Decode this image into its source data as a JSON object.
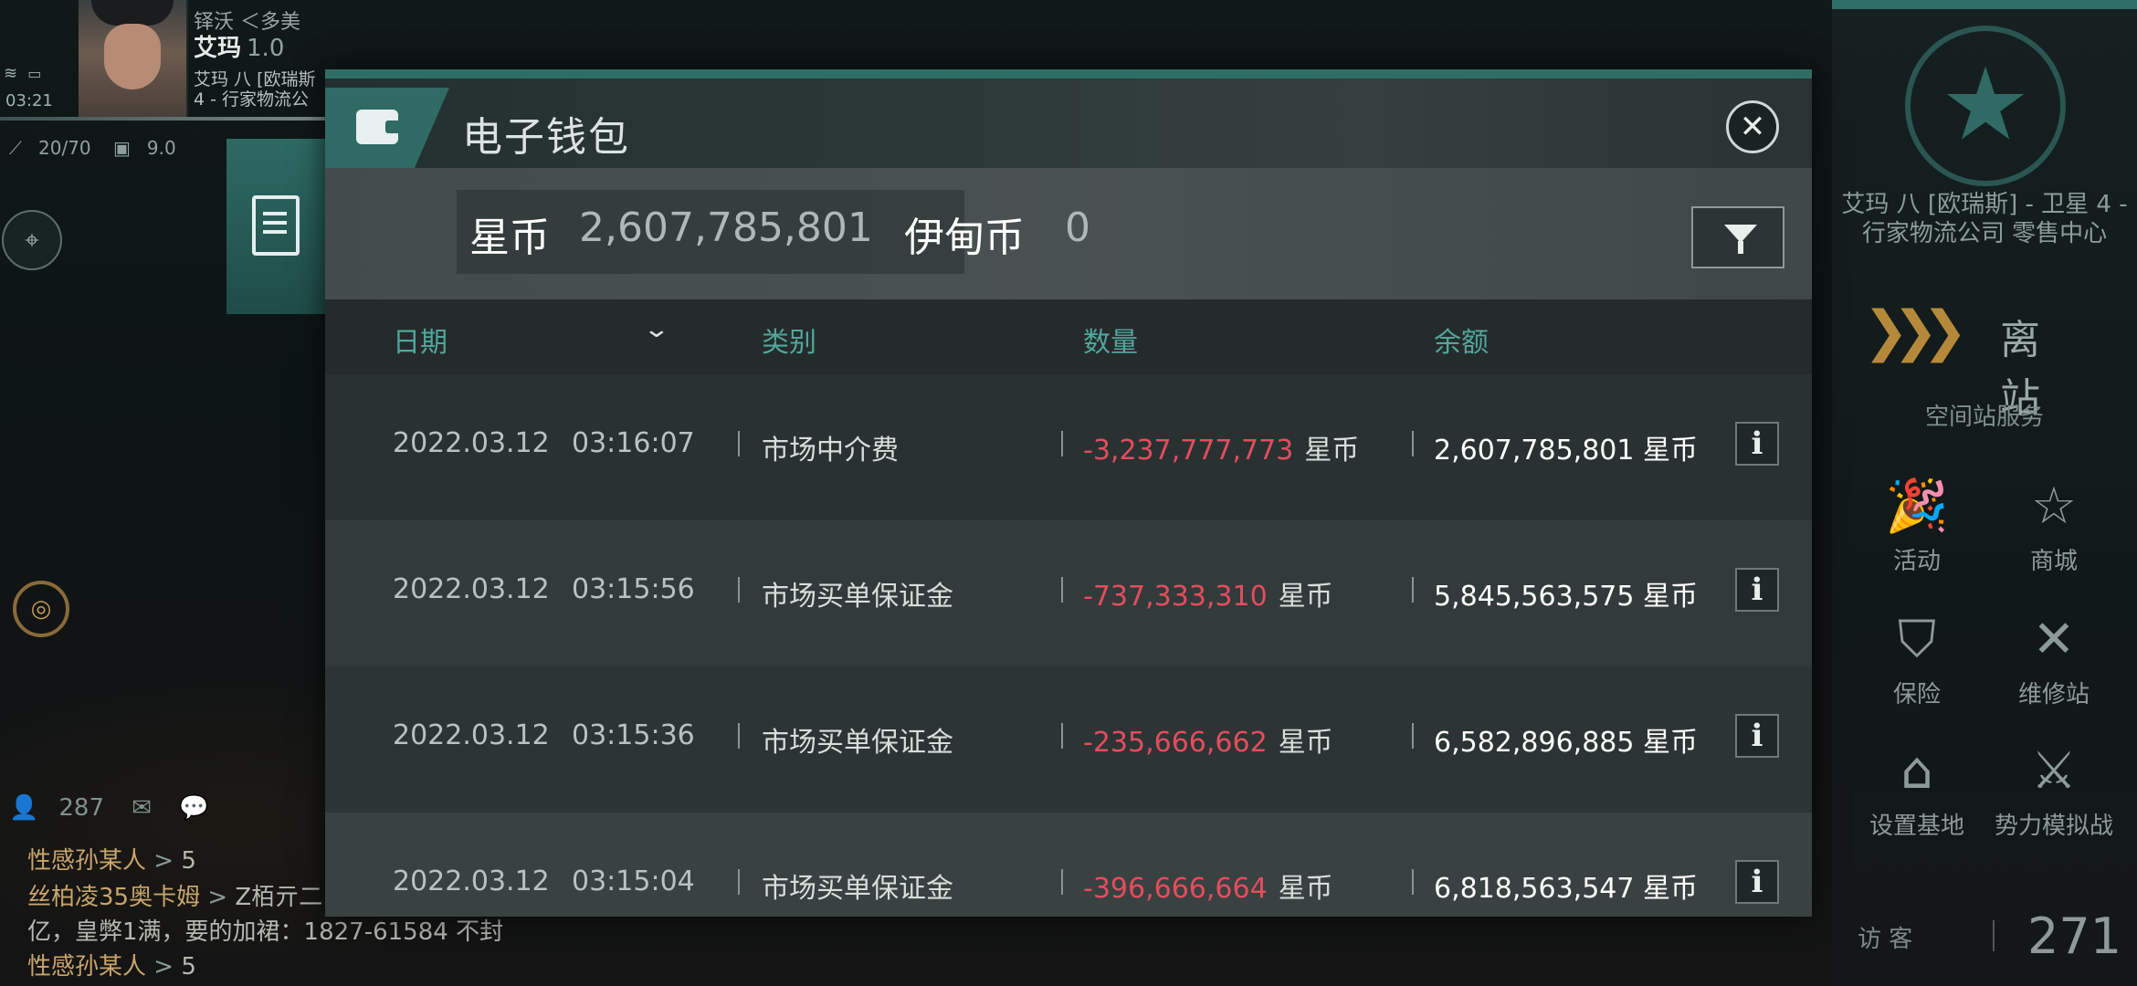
{
  "hud": {
    "time": "03:21",
    "corp": "铎沃 ＜多美",
    "pilot_name": "艾玛",
    "security": "1.0",
    "location_line1": "艾玛 八 [欧瑞斯",
    "location_line2": "4 - 行家物流公",
    "cargo": "20/70",
    "volume": "9.0",
    "contacts": "287"
  },
  "chat": [
    {
      "sender": "性感孙某人",
      "arrow": ">",
      "text": "5"
    },
    {
      "sender": "丝柏凌35奥卡姆",
      "arrow": ">",
      "text": "Z栢亓二"
    },
    {
      "sender": "",
      "arrow": "",
      "text": "亿，皇弊1满，要的加裙：1827-61584 不封"
    },
    {
      "sender": "性感孙某人",
      "arrow": ">",
      "text": "5"
    }
  ],
  "wallet": {
    "title": "电子钱包",
    "isk_label": "星币",
    "isk_value": "2,607,785,801",
    "plex_label": "伊甸币",
    "plex_value": "0",
    "columns": {
      "date": "日期",
      "category": "类别",
      "amount": "数量",
      "balance": "余额"
    },
    "info_label": "i",
    "rows": [
      {
        "date": "2022.03.12",
        "time": "03:16:07",
        "category": "市场中介费",
        "amount": "-3,237,777,773",
        "unit": "星币",
        "balance": "2,607,785,801 星币"
      },
      {
        "date": "2022.03.12",
        "time": "03:15:56",
        "category": "市场买单保证金",
        "amount": "-737,333,310",
        "unit": "星币",
        "balance": "5,845,563,575 星币"
      },
      {
        "date": "2022.03.12",
        "time": "03:15:36",
        "category": "市场买单保证金",
        "amount": "-235,666,662",
        "unit": "星币",
        "balance": "6,582,896,885 星币"
      },
      {
        "date": "2022.03.12",
        "time": "03:15:04",
        "category": "市场买单保证金",
        "amount": "-396,666,664",
        "unit": "星币",
        "balance": "6,818,563,547 星币"
      }
    ]
  },
  "station": {
    "name": "艾玛 八 [欧瑞斯] - 卫星 4 - 行家物流公司 零售中心",
    "undock_label": "离 站",
    "services_title": "空间站服务",
    "services": [
      {
        "label": "活动",
        "icon": "party-popper-icon"
      },
      {
        "label": "商城",
        "icon": "star-shop-icon"
      },
      {
        "label": "保险",
        "icon": "insurance-shield-icon"
      },
      {
        "label": "维修站",
        "icon": "wrench-icon"
      },
      {
        "label": "设置基地",
        "icon": "base-icon"
      },
      {
        "label": "势力模拟战",
        "icon": "crossed-flags-icon"
      }
    ],
    "visitor_label": "访 客",
    "visitor_count": "271"
  },
  "colors": {
    "accent": "#2f6b64",
    "negative": "#e34d5e",
    "header_text": "#4fa79b"
  }
}
